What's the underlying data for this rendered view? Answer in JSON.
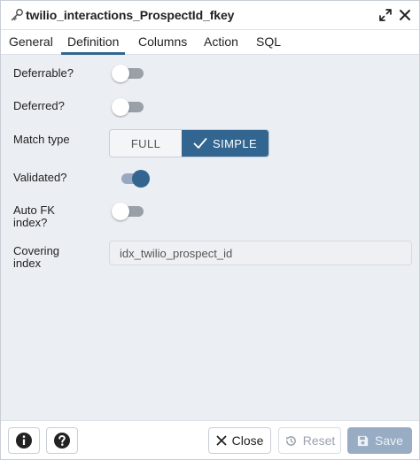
{
  "dialog": {
    "title": "twilio_interactions_ProspectId_fkey",
    "title_icon": "key-icon"
  },
  "tabs": [
    {
      "label": "General",
      "active": false
    },
    {
      "label": "Definition",
      "active": true
    },
    {
      "label": "Columns",
      "active": false
    },
    {
      "label": "Action",
      "active": false
    },
    {
      "label": "SQL",
      "active": false
    }
  ],
  "form": {
    "deferrable": {
      "label": "Deferrable?",
      "value": false
    },
    "deferred": {
      "label": "Deferred?",
      "value": false
    },
    "match_type": {
      "label": "Match type",
      "options": [
        "FULL",
        "SIMPLE"
      ],
      "selected": "SIMPLE"
    },
    "validated": {
      "label": "Validated?",
      "value": true
    },
    "auto_fk_index": {
      "label_line1": "Auto FK",
      "label_line2": "index?",
      "value": false
    },
    "covering_index": {
      "label_line1": "Covering",
      "label_line2": "index",
      "value": "idx_twilio_prospect_id"
    }
  },
  "footer": {
    "info_icon": "info-icon",
    "help_icon": "help-icon",
    "close_label": "Close",
    "reset_label": "Reset",
    "save_label": "Save"
  },
  "colors": {
    "accent": "#326690",
    "background": "#ebeef3"
  }
}
